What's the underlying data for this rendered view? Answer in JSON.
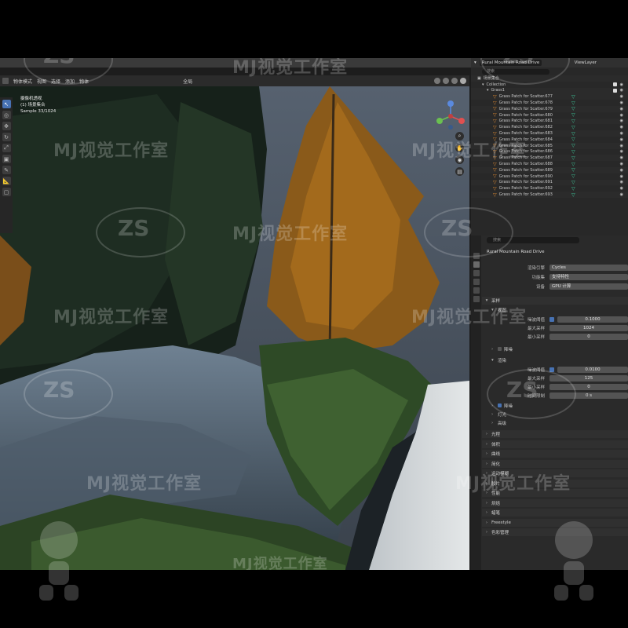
{
  "viewport": {
    "menu": [
      "物体模式",
      "视图",
      "选择",
      "添加",
      "物体"
    ],
    "transform": "全局",
    "info": {
      "line1": "摄像机透视",
      "line2": "(1) 场景集合",
      "line3": "Sample 33/1024"
    }
  },
  "outliner": {
    "scene": "Rural Mountain Road Drive",
    "view_layer": "ViewLayer",
    "collection_root": "场景集合",
    "collection": "Collection",
    "group": "Grass1",
    "items": [
      "Grass Patch for Scatter.677",
      "Grass Patch for Scatter.678",
      "Grass Patch for Scatter.679",
      "Grass Patch for Scatter.680",
      "Grass Patch for Scatter.681",
      "Grass Patch for Scatter.682",
      "Grass Patch for Scatter.683",
      "Grass Patch for Scatter.684",
      "Grass Patch for Scatter.685",
      "Grass Patch for Scatter.686",
      "Grass Patch for Scatter.687",
      "Grass Patch for Scatter.688",
      "Grass Patch for Scatter.689",
      "Grass Patch for Scatter.690",
      "Grass Patch for Scatter.691",
      "Grass Patch for Scatter.692",
      "Grass Patch for Scatter.693"
    ]
  },
  "properties": {
    "search_placeholder": "搜索",
    "options": "选项",
    "scene_name": "Rural Mountain Road Drive",
    "render_engine_label": "渲染引擎",
    "render_engine": "Cycles",
    "feature_set_label": "功能集",
    "feature_set": "支持特性",
    "device_label": "设备",
    "device": "GPU 计算",
    "sampling": "采样",
    "viewport_section": "视图",
    "noise_threshold_label": "噪波阈值",
    "viewport_noise_threshold": "0.1000",
    "max_samples_label": "最大采样",
    "viewport_max_samples": "1024",
    "min_samples_label": "最小采样",
    "viewport_min_samples": "0",
    "denoise": "降噪",
    "render_section": "渲染",
    "render_noise_threshold": "0.0100",
    "render_max_samples": "125",
    "render_min_samples": "0",
    "time_limit_label": "时间限制",
    "render_time_limit": "0 s",
    "render_denoise": "降噪",
    "lights": "灯光",
    "advanced": "高级",
    "sections": [
      "光程",
      "体积",
      "曲线",
      "简化",
      "运动模糊",
      "胶片",
      "性能",
      "烘焙",
      "蜡笔",
      "Freestyle",
      "色彩管理"
    ]
  },
  "watermark": {
    "text": "MJ视觉工作室",
    "logo": "ZS"
  }
}
